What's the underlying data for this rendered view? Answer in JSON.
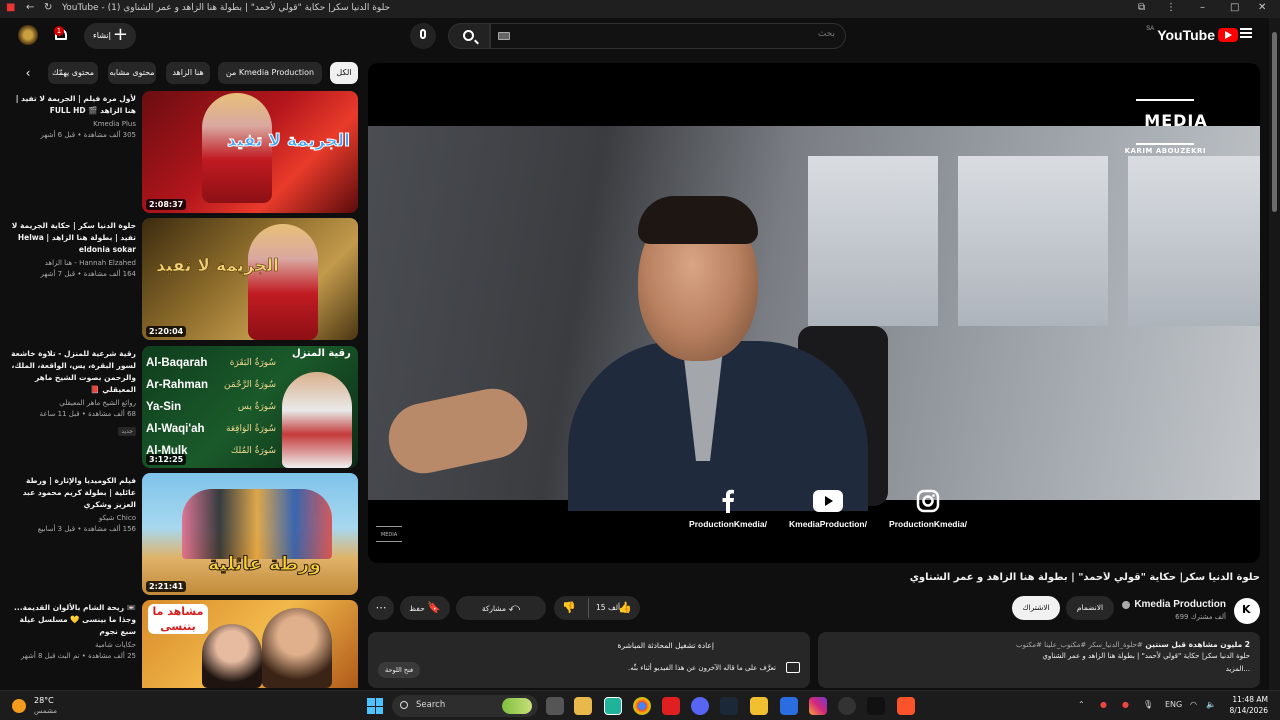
{
  "window": {
    "title": "YouTube - حلوة الدنيا سكر| حكاية \"قولي لأحمد\" | بطولة هنا الزاهد و عمر الشناوي (1)"
  },
  "masthead": {
    "logo_text": "YouTube",
    "region": "SA",
    "search_placeholder": "بحث",
    "create_label": "إنشاء",
    "notification_count": "1"
  },
  "chips": [
    {
      "label": "الكل",
      "active": true
    },
    {
      "label": "من Kmedia Production",
      "active": false
    },
    {
      "label": "هنا الزاهد",
      "active": false
    },
    {
      "label": "محتوى مشابه",
      "active": false
    },
    {
      "label": "محتوى يهمّك",
      "active": false
    }
  ],
  "related": [
    {
      "title": "لأول مرة فيلم | الجريمة لا تفيد | هنا الزاهد 🎬 FULL HD",
      "channel": "Kmedia Plus",
      "meta": "305 ألف مشاهدة • قبل 6 أشهر",
      "duration": "2:08:37",
      "thumb_text": "الجريمة لا تفيد"
    },
    {
      "title": "حلوة الدنيا سكر | حكاية الجريمة لا تفيد | بطولة هنا الزاهد | Helwa eldonia sokar",
      "channel": "Hannah Elzahed - هنا الزاهد",
      "meta": "164 ألف مشاهدة • قبل 7 أشهر",
      "duration": "2:20:04",
      "thumb_text": "الجريمة لا تفيد"
    },
    {
      "title": "رقية شرعية للمنزل - تلاوة خاشعة لسور البقرة، يس، الواقعة، الملك، والرحمن بصوت الشيخ ماهر المعيقلي 📕",
      "channel": "روائع الشيخ ماهر المعيقلي",
      "meta": "68 ألف مشاهدة • قبل 11 ساعة",
      "badge": "جديد",
      "duration": "3:12:25",
      "thumb_heading": "رقية المنزل",
      "surahs": [
        "Al-Baqarah",
        "Ar-Rahman",
        "Ya-Sin",
        "Al-Waqi'ah",
        "Al-Mulk"
      ],
      "surahs_ar": [
        "سُورَةُ البَقَرَة",
        "سُورَةُ الرَّحْمَن",
        "سُورَةُ يس",
        "سُورَةُ الوَاقِعَة",
        "سُورَةُ المُلك"
      ]
    },
    {
      "title": "فيلم الكوميديا والإثارة | ورطة عائلية | بطولة كريم محمود عبد العزيز وشكري",
      "channel": "Chico شيكو",
      "meta": "156 ألف مشاهدة • قبل 3 أسابيع",
      "duration": "2:21:41",
      "thumb_text": "ورطة عائلية"
    },
    {
      "title": "📼 ريحة الشام بالألوان القديمة... وجذا ما بينسى 💛 مسلسل عيلة سبع نجوم",
      "channel": "حكايات شامية",
      "meta": "25 ألف مشاهدة • تم البث قبل 8 أشهر",
      "duration": "",
      "thumb_text": "مشاهد ما بتنسى"
    }
  ],
  "player": {
    "logo_text": "MEDIA",
    "logo_sub": "KARIM ABOUZEKRI",
    "socials": [
      {
        "icon": "facebook-icon",
        "label": "ProductionKmedia/"
      },
      {
        "icon": "youtube-icon",
        "label": "KmediaProduction/"
      },
      {
        "icon": "instagram-icon",
        "label": "ProductionKmedia/"
      }
    ]
  },
  "video": {
    "title": "حلوة الدنيا سكر| حكاية \"قولي لأحمد\" | بطولة هنا الزاهد و عمر الشناوي",
    "channel": "Kmedia Production",
    "subscribers": "699 ألف مشترك",
    "join_label": "الانضمام",
    "subscribe_label": "الاشتراك",
    "likes": "15 ألف",
    "share_label": "مشاركة",
    "save_label": "حفظ",
    "views": "2 مليون مشاهدة",
    "date": "قبل سنتين",
    "tags": "#حلوة_الدنيا_سكر #مكتوب_علينا #مكتوب",
    "description": "حلوة الدنيا سكر| حكاية \"قولي لأحمد\" | بطولة هنا الزاهد و عمر الشناوي",
    "more": "...المزيد"
  },
  "chat": {
    "title": "إعادة تشغيل المحادثة المباشرة",
    "desc": "تعرَّف على ما قاله الآخرون عن هذا الفيديو أثناء بثّه.",
    "button": "فتح اللوحة"
  },
  "taskbar": {
    "temp": "28°C",
    "condition": "مشمس",
    "search": "Search",
    "lang": "ENG",
    "time": "11:48 AM",
    "date": "8/14/2026"
  },
  "colors": {
    "background": "#0f0f0f",
    "accent": "#ff0000",
    "chip": "#272727"
  }
}
